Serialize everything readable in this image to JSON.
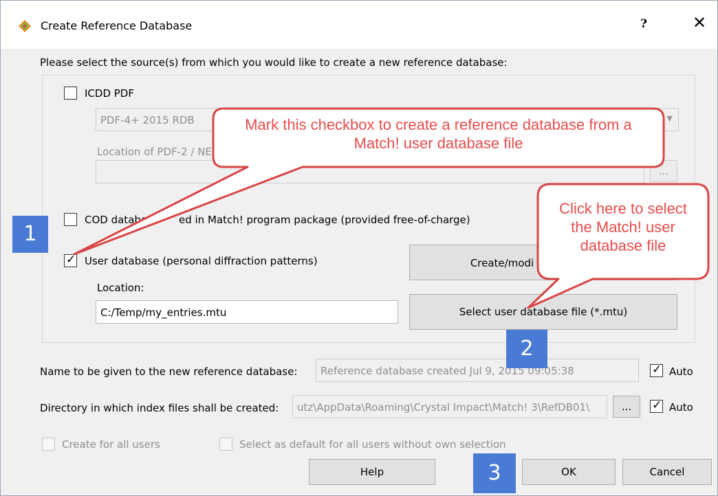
{
  "window": {
    "title": "Create Reference Database",
    "help_glyph": "?",
    "close_glyph": "✕"
  },
  "intro": "Please select the source(s) from which you would like to create a new reference database:",
  "icdd": {
    "label": "ICDD PDF",
    "checked": false,
    "combo_value": "PDF-4+ 2015 RDB",
    "location_label": "Location of PDF-2 / NE",
    "location_value": "",
    "browse": "..."
  },
  "cod": {
    "label_start": "COD databas",
    "label_end": "ed in Match! program package (provided free-of-charge)",
    "checked": false
  },
  "user_db": {
    "label": "User database (personal diffraction patterns)",
    "checked": true,
    "create_button": "Create/modi",
    "location_label": "Location:",
    "location_value": "C:/Temp/my_entries.mtu",
    "select_button": "Select user database file (*.mtu)"
  },
  "name_row": {
    "label": "Name to be given to the new reference database:",
    "value": "Reference database created Jul 9, 2015 09:05:38",
    "auto": "Auto"
  },
  "dir_row": {
    "label": "Directory in which index files shall be created:",
    "value": "utz\\AppData\\Roaming\\Crystal Impact\\Match! 3\\RefDB01\\",
    "browse": "...",
    "auto": "Auto"
  },
  "options": {
    "all_users": "Create for all users",
    "default_all": "Select as default for all users without own selection"
  },
  "buttons": {
    "help": "Help",
    "ok": "OK",
    "cancel": "Cancel"
  },
  "annotations": {
    "callout_checkbox": "Mark this checkbox to create a reference database from a Match! user database file",
    "callout_select": "Click here to select the Match! user database file",
    "badge1": "1",
    "badge2": "2",
    "badge3": "3"
  },
  "colors": {
    "callout_fill": "#ffffff",
    "callout_border": "#d84545",
    "callout_text": "#e74c4c",
    "badge": "#4a7bd4"
  }
}
